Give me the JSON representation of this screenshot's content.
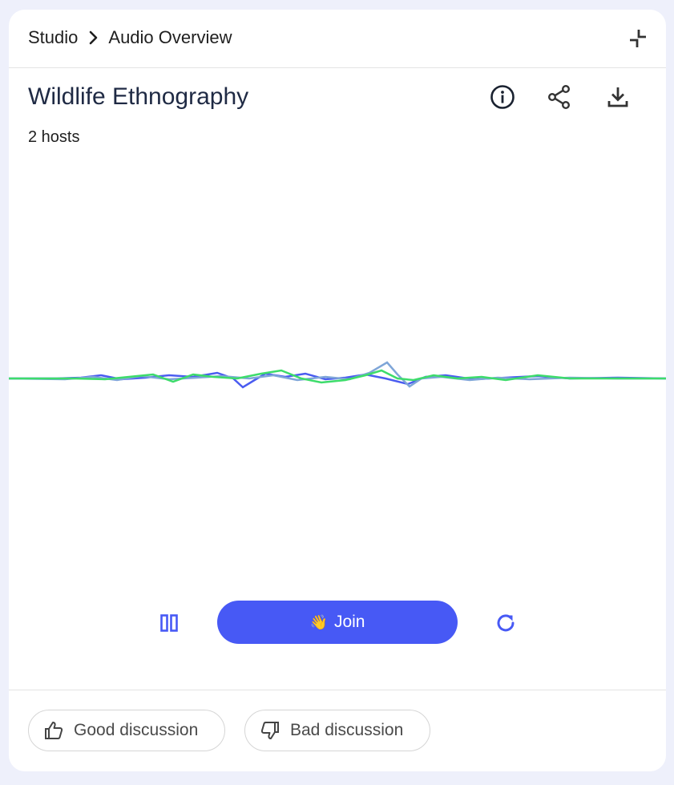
{
  "breadcrumb": {
    "root": "Studio",
    "current": "Audio Overview"
  },
  "audio": {
    "title": "Wildlife Ethnography",
    "hosts": "2 hosts"
  },
  "controls": {
    "join_label": "Join",
    "join_emoji": "👋"
  },
  "feedback": {
    "good_label": "Good discussion",
    "bad_label": "Bad discussion"
  },
  "colors": {
    "accent": "#4759f5",
    "wave_blue": "#4a5cf0",
    "wave_light": "#7fa6d8",
    "wave_green": "#3ddc6b"
  },
  "icons": [
    "chevron-right-icon",
    "collapse-icon",
    "info-icon",
    "share-icon",
    "download-icon",
    "pause-icon",
    "replay-icon",
    "thumb-up-icon",
    "thumb-down-icon"
  ]
}
